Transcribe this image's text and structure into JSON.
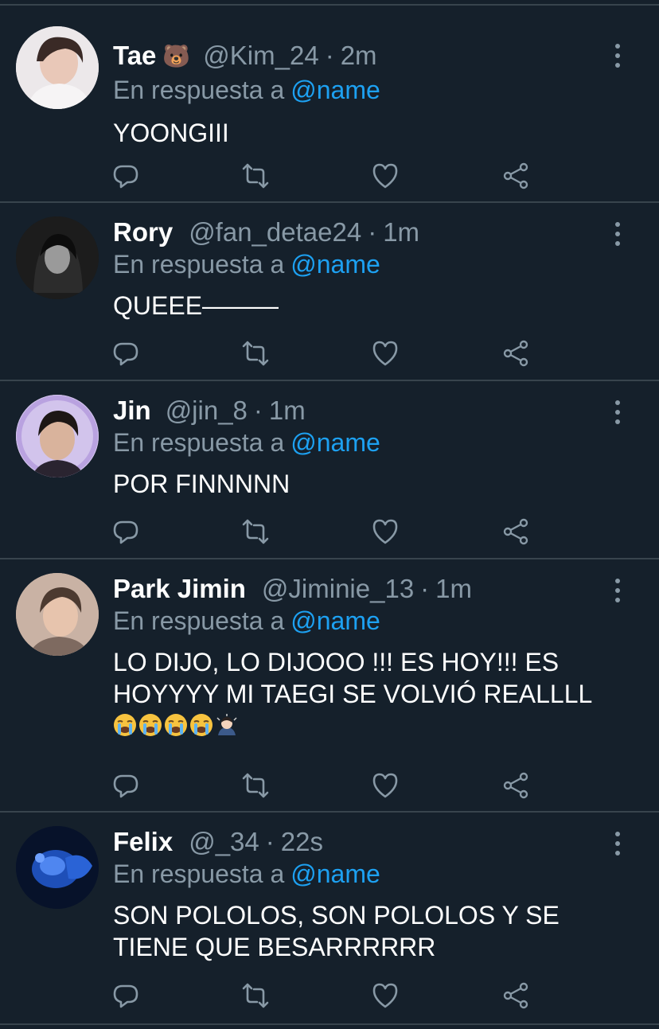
{
  "reply_prefix": "En respuesta a",
  "tweets": [
    {
      "name": "Tae",
      "badge": "🐻",
      "handle": "@Kim_24",
      "separator": "·",
      "time": "2m",
      "reply_to": "@name",
      "text": "YOONGIII",
      "avatar_icon": "avatar-photo"
    },
    {
      "name": "Rory",
      "handle": "@fan_detae24",
      "separator": "·",
      "time": "1m",
      "reply_to": "@name",
      "text": "QUEEE———",
      "avatar_icon": "avatar-photo"
    },
    {
      "name": "Jin",
      "handle": "@jin_8",
      "separator": "·",
      "time": "1m",
      "reply_to": "@name",
      "text": "POR FINNNNN",
      "avatar_icon": "avatar-photo"
    },
    {
      "name": "Park Jimin",
      "handle": "@Jiminie_13",
      "separator": "·",
      "time": "1m",
      "reply_to": "@name",
      "text": "LO DIJO, LO DIJOOO !!! ES HOY!!! ES HOYYYY MI TAEGI SE VOLVIÓ REALLLL",
      "emojis": [
        "loudly-crying-face",
        "loudly-crying-face",
        "loudly-crying-face",
        "loudly-crying-face",
        "person-bowing"
      ],
      "avatar_icon": "avatar-photo"
    },
    {
      "name": "Felix",
      "handle": "@_34",
      "separator": "·",
      "time": "22s",
      "reply_to": "@name",
      "text": "SON POLOLOS, SON POLOLOS Y SE TIENE QUE BESARRRRRR",
      "avatar_icon": "avatar-photo"
    }
  ],
  "icons": {
    "reply": "reply-icon",
    "retweet": "retweet-icon",
    "like": "like-icon",
    "share": "share-icon",
    "more": "more-icon"
  },
  "colors": {
    "background": "#15202b",
    "divider": "#38444d",
    "secondary_text": "#8899a6",
    "mention": "#1da1f2",
    "primary_text": "#ffffff"
  }
}
